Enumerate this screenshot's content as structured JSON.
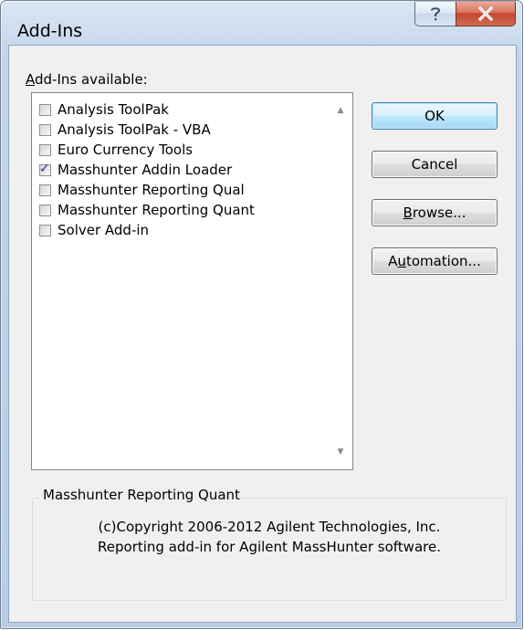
{
  "window": {
    "title": "Add-Ins",
    "help_glyph": "?",
    "close_glyph": "X"
  },
  "addins": {
    "label_accel": "A",
    "label_rest": "dd-Ins available:",
    "items": [
      {
        "label": "Analysis ToolPak",
        "checked": false
      },
      {
        "label": "Analysis ToolPak - VBA",
        "checked": false
      },
      {
        "label": "Euro Currency Tools",
        "checked": false
      },
      {
        "label": "Masshunter Addin Loader",
        "checked": true
      },
      {
        "label": "Masshunter Reporting Qual",
        "checked": false
      },
      {
        "label": "Masshunter Reporting Quant",
        "checked": false
      },
      {
        "label": "Solver Add-in",
        "checked": false
      }
    ],
    "check_glyph": "✓",
    "scroll_up_glyph": "▲",
    "scroll_down_glyph": "▼"
  },
  "buttons": {
    "ok": "OK",
    "cancel": "Cancel",
    "browse_accel": "B",
    "browse_rest": "rowse...",
    "automation_pre": "A",
    "automation_accel": "u",
    "automation_rest": "tomation..."
  },
  "details": {
    "title": "Masshunter Reporting Quant",
    "line1": "(c)Copyright 2006-2012 Agilent Technologies, Inc.",
    "line2": "Reporting add-in for Agilent MassHunter software."
  }
}
